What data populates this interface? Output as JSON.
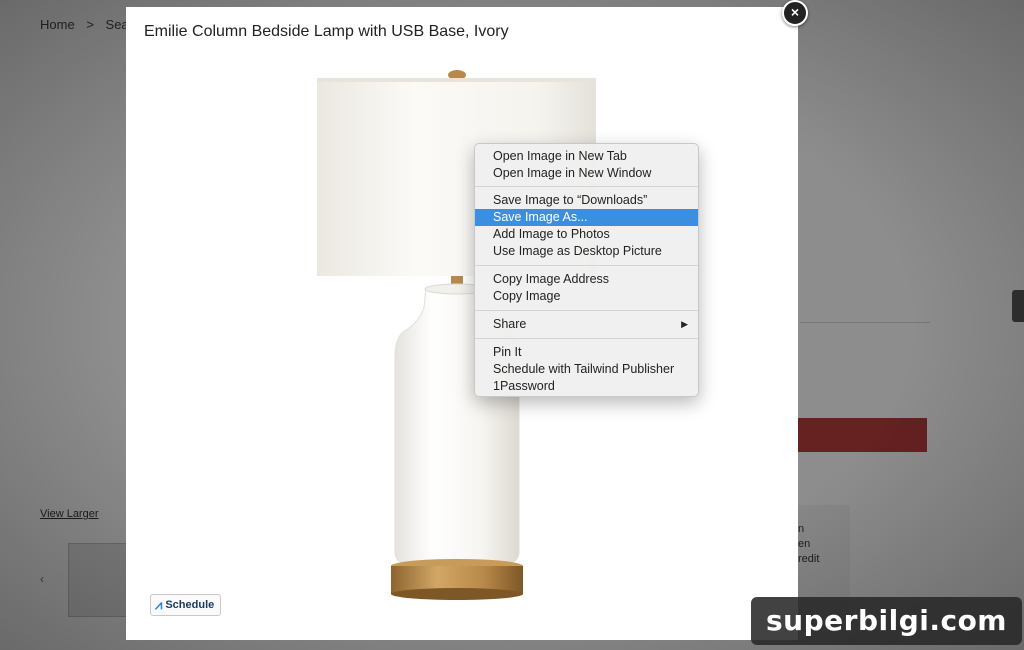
{
  "background": {
    "breadcrumb": [
      "Home",
      ">",
      "Sear"
    ],
    "view_larger": "View Larger",
    "side_text": [
      "n",
      "en",
      "redit"
    ]
  },
  "modal": {
    "title": "Emilie Column Bedside Lamp with USB Base, Ivory",
    "close_label": "×",
    "schedule_button": "Schedule",
    "schedule_icon": "tailwind-icon"
  },
  "context_menu": {
    "items": [
      "Open Image in New Tab",
      "Open Image in New Window",
      "Save Image to “Downloads”",
      "Save Image As...",
      "Add Image to Photos",
      "Use Image as Desktop Picture",
      "Copy Image Address",
      "Copy Image",
      "Share",
      "Pin It",
      "Schedule with Tailwind Publisher",
      "1Password"
    ],
    "selected": "Save Image As...",
    "submenu_arrow": "▶"
  },
  "watermark": "superbilgi.com",
  "colors": {
    "selection": "#3a8fe0",
    "accent_red": "#b03a3a",
    "lamp_shade": "#f7f5f0",
    "lamp_base_brass": "#b8894a"
  }
}
